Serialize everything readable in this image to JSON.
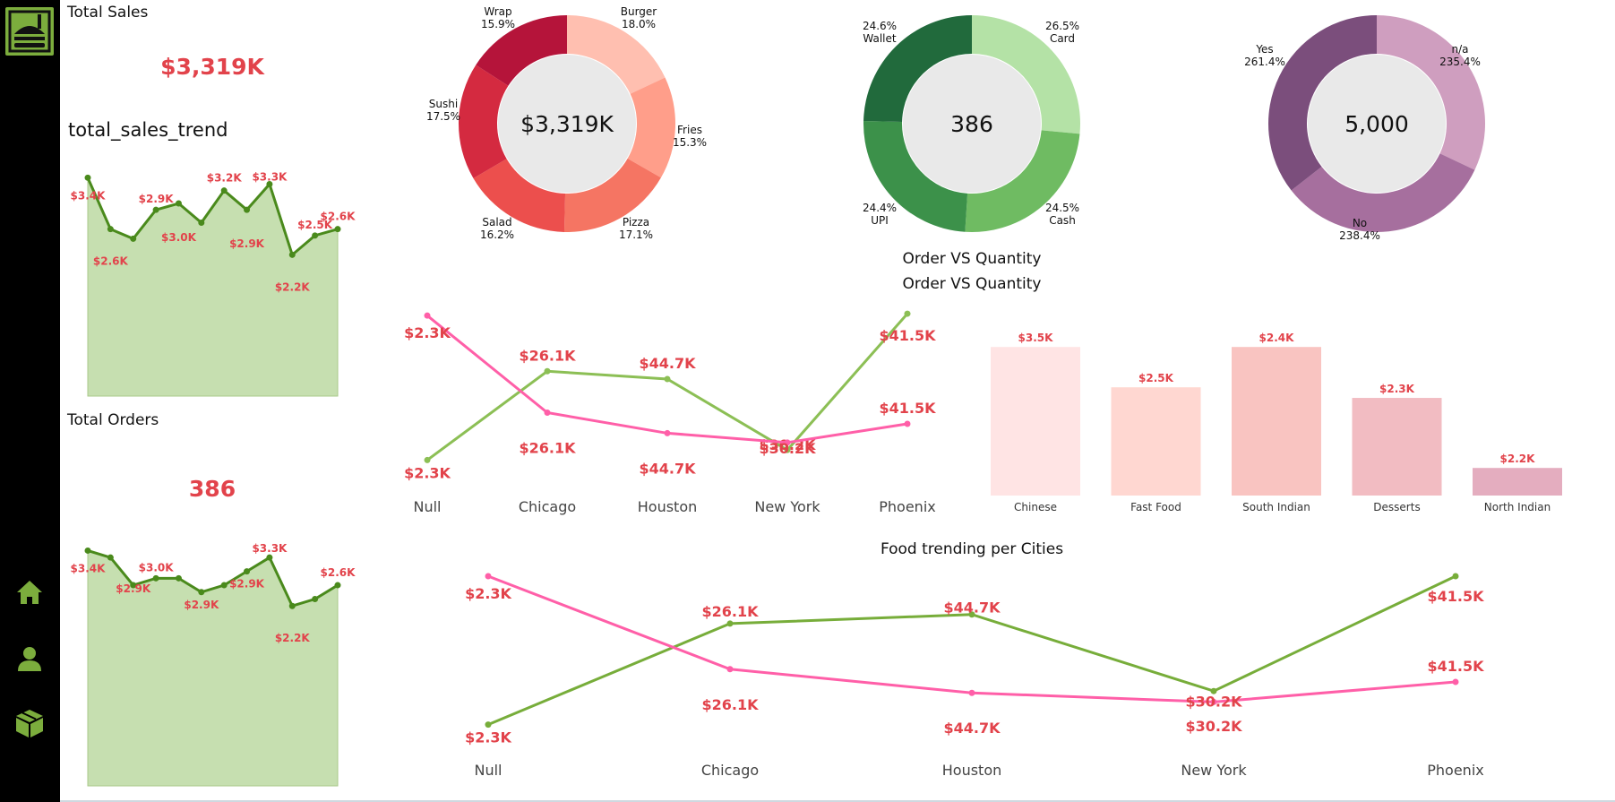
{
  "sidebar": {
    "logo_icon": "food-delivery-logo-icon",
    "items": [
      {
        "name": "home",
        "icon": "home-icon"
      },
      {
        "name": "customers",
        "icon": "user-icon"
      },
      {
        "name": "products",
        "icon": "box-icon"
      }
    ],
    "accent": "#7cad3d"
  },
  "kpis": {
    "total_sales": {
      "title": "Total Sales",
      "value": "$3,319K"
    },
    "total_sales_trend_title": "total_sales_trend",
    "total_orders": {
      "title": "Total Orders",
      "value": "386"
    }
  },
  "chart_data": [
    {
      "id": "sales-trend",
      "type": "area",
      "values": [
        3.4,
        2.6,
        2.45,
        2.9,
        3.0,
        2.7,
        3.2,
        2.9,
        3.3,
        2.2,
        2.5,
        2.6
      ],
      "labels": [
        "$3.4K",
        "$2.6K",
        "",
        "$2.9K",
        "$3.0K",
        "",
        "$3.2K",
        "$2.9K",
        "$3.3K",
        "$2.2K",
        "$2.5K",
        "$2.6K"
      ],
      "ylim": [
        0,
        3.6
      ],
      "colors": {
        "line": "#4a8a1c",
        "fill": "#c6dfb0",
        "label": "#e2434b"
      }
    },
    {
      "id": "orders-trend",
      "type": "area",
      "values": [
        3.4,
        3.3,
        2.9,
        3.0,
        3.0,
        2.8,
        2.9,
        3.1,
        3.3,
        2.6,
        2.7,
        2.9
      ],
      "labels": [
        "$3.4K",
        "",
        "$2.9K",
        "$3.0K",
        "",
        "$2.9K",
        "",
        "$2.9K",
        "$3.3K",
        "$2.2K",
        "",
        "$2.6K"
      ],
      "ylim": [
        0,
        3.6
      ],
      "colors": {
        "line": "#4a8a1c",
        "fill": "#c6dfb0",
        "label": "#e2434b"
      }
    },
    {
      "id": "category-donut",
      "type": "pie",
      "center_label": "$3,319K",
      "slices": [
        {
          "name": "Burger",
          "pct": "18.0%",
          "value": 18.0,
          "color": "#ffbfb0"
        },
        {
          "name": "Fries",
          "pct": "15.3%",
          "value": 15.3,
          "color": "#ff9e8a"
        },
        {
          "name": "Pizza",
          "pct": "17.1%",
          "value": 17.1,
          "color": "#f57563"
        },
        {
          "name": "Salad",
          "pct": "16.2%",
          "value": 16.2,
          "color": "#ec4f4d"
        },
        {
          "name": "Sushi",
          "pct": "17.5%",
          "value": 17.5,
          "color": "#d42a40"
        },
        {
          "name": "Wrap",
          "pct": "15.9%",
          "value": 15.9,
          "color": "#b5143a"
        }
      ]
    },
    {
      "id": "payment-donut",
      "type": "pie",
      "center_label": "386",
      "slices": [
        {
          "name": "Card",
          "pct": "26.5%",
          "value": 26.5,
          "color": "#b4e2a6"
        },
        {
          "name": "Cash",
          "pct": "24.5%",
          "value": 24.5,
          "color": "#6fbb62"
        },
        {
          "name": "UPI",
          "pct": "24.4%",
          "value": 24.4,
          "color": "#3c914a"
        },
        {
          "name": "Wallet",
          "pct": "24.6%",
          "value": 24.6,
          "color": "#216a3c"
        }
      ]
    },
    {
      "id": "yesno-donut",
      "type": "pie",
      "center_label": "5,000",
      "slices": [
        {
          "name": "n/a",
          "pct": "235.4%",
          "value": 235.4,
          "color": "#cf9ebf"
        },
        {
          "name": "No",
          "pct": "238.4%",
          "value": 238.4,
          "color": "#a66f9e"
        },
        {
          "name": "Yes",
          "pct": "261.4%",
          "value": 261.4,
          "color": "#7b4e7c"
        }
      ]
    },
    {
      "id": "order-vs-quantity",
      "type": "line",
      "title": "Order VS Quantity",
      "subtitle": "Order VS Quantity",
      "categories": [
        "Null",
        "Chicago",
        "Houston",
        "New York",
        "Phoenix"
      ],
      "series": [
        {
          "values": [
            2.3,
            26.1,
            24.0,
            5.0,
            41.5
          ],
          "labels": [
            "$2.3K",
            "$26.1K",
            "$44.7K",
            "$30.2K",
            "$41.5K"
          ],
          "color": "#8cbf55"
        },
        {
          "values": [
            41.0,
            15.0,
            9.5,
            7.0,
            12.0
          ],
          "labels": [
            "$2.3K",
            "$26.1K",
            "$44.7K",
            "$30.2K",
            "$41.5K"
          ],
          "color": "#ff5fa8"
        }
      ],
      "label_color": "#e2434b"
    },
    {
      "id": "cuisine-bars",
      "type": "bar",
      "categories": [
        "Chinese",
        "Fast Food",
        "South Indian",
        "Desserts",
        "North Indian"
      ],
      "values": [
        3.5,
        2.5,
        2.4,
        2.3,
        2.2
      ],
      "heights": [
        3.5,
        2.55,
        3.5,
        2.3,
        0.65
      ],
      "labels": [
        "$3.5K",
        "$2.5K",
        "$2.4K",
        "$2.3K",
        "$2.2K"
      ],
      "colors": [
        "#ffe4e4",
        "#ffd7d1",
        "#f9c4c1",
        "#f2bcc2",
        "#e4adbf"
      ],
      "ylim": [
        0,
        3.8
      ],
      "label_color": "#e2434b"
    },
    {
      "id": "food-trending",
      "type": "line",
      "title": "Food trending per Cities",
      "categories": [
        "Null",
        "Chicago",
        "Houston",
        "New York",
        "Phoenix"
      ],
      "series": [
        {
          "values": [
            2.3,
            30.0,
            32.5,
            11.5,
            43.0
          ],
          "labels": [
            "$2.3K",
            "$26.1K",
            "$44.7K",
            "$30.2K",
            "$41.5K"
          ],
          "color": "#77ad3a"
        },
        {
          "values": [
            43.0,
            17.5,
            11.0,
            8.5,
            14.0
          ],
          "labels": [
            "$2.3K",
            "$26.1K",
            "$44.7K",
            "$30.2K",
            "$41.5K"
          ],
          "color": "#ff5fa8"
        }
      ],
      "label_color": "#e2434b"
    }
  ]
}
